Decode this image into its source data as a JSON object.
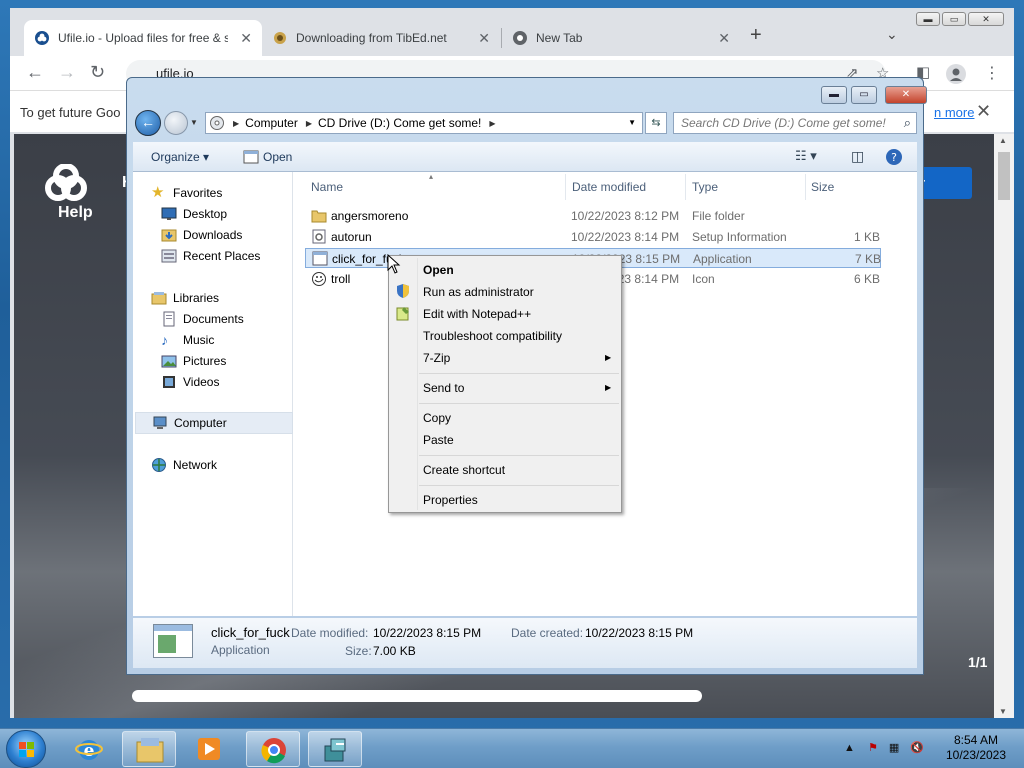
{
  "browser": {
    "tabs": [
      {
        "title": "Ufile.io - Upload files for free & s",
        "active": true
      },
      {
        "title": "Downloading from TibEd.net",
        "active": false
      },
      {
        "title": "New Tab",
        "active": false
      }
    ],
    "url": "ufile.io",
    "infobar_text": "To get future Goo",
    "infobar_link": "n more"
  },
  "webpage": {
    "help_label": "Help",
    "h_letter": "H",
    "button_text": "r",
    "page_count": "1/1"
  },
  "explorer": {
    "breadcrumb": [
      "Computer",
      "CD Drive (D:) Come get some!"
    ],
    "search_placeholder": "Search CD Drive (D:) Come get some!",
    "toolbar": {
      "organize": "Organize",
      "open": "Open"
    },
    "nav": {
      "favorites": "Favorites",
      "desktop": "Desktop",
      "downloads": "Downloads",
      "recent": "Recent Places",
      "libraries": "Libraries",
      "documents": "Documents",
      "music": "Music",
      "pictures": "Pictures",
      "videos": "Videos",
      "computer": "Computer",
      "network": "Network"
    },
    "columns": {
      "name": "Name",
      "date": "Date modified",
      "type": "Type",
      "size": "Size"
    },
    "files": [
      {
        "name": "angersmoreno",
        "date": "10/22/2023 8:12 PM",
        "type": "File folder",
        "size": ""
      },
      {
        "name": "autorun",
        "date": "10/22/2023 8:14 PM",
        "type": "Setup Information",
        "size": "1 KB"
      },
      {
        "name": "click_for_fuck",
        "date": "10/22/2023 8:15 PM",
        "type": "Application",
        "size": "7 KB"
      },
      {
        "name": "troll",
        "date": "10/22/2023 8:14 PM",
        "type": "Icon",
        "size": "6 KB"
      }
    ],
    "details": {
      "name": "click_for_fuck",
      "type": "Application",
      "modified_label": "Date modified:",
      "modified": "10/22/2023 8:15 PM",
      "created_label": "Date created:",
      "created": "10/22/2023 8:15 PM",
      "size_label": "Size:",
      "size": "7.00 KB"
    }
  },
  "context_menu": {
    "open": "Open",
    "run_admin": "Run as administrator",
    "edit_npp": "Edit with Notepad++",
    "troubleshoot": "Troubleshoot compatibility",
    "zip": "7-Zip",
    "send_to": "Send to",
    "copy": "Copy",
    "paste": "Paste",
    "shortcut": "Create shortcut",
    "properties": "Properties"
  },
  "taskbar": {
    "time": "8:54 AM",
    "date": "10/23/2023"
  },
  "colors": {
    "accent": "#1366c6",
    "selection": "#d9e9fa",
    "taskbar": "#6f9ec8"
  }
}
